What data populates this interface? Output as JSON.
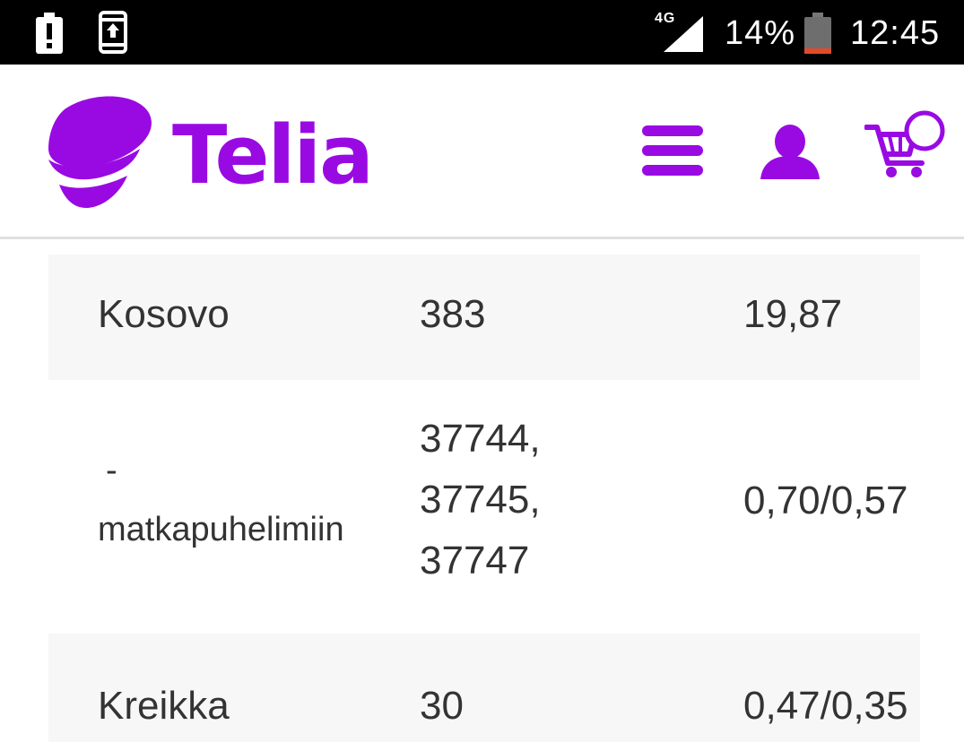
{
  "status_bar": {
    "network_type": "4G",
    "battery_percent": "14%",
    "time": "12:45",
    "icons": [
      "battery-alert-icon",
      "upload-icon",
      "signal-icon",
      "battery-icon"
    ],
    "battery_level": 0.14
  },
  "header": {
    "logo_text": "Telia",
    "brand_color": "#990ae3",
    "icons": [
      "menu-icon",
      "user-icon",
      "cart-icon"
    ]
  },
  "table": {
    "rows": [
      {
        "name": "Kosovo",
        "code": "383",
        "price": "19,87"
      },
      {
        "name_dash": "-",
        "name": "matkapuhelimiin",
        "code_lines": [
          "37744,",
          "37745,",
          "37747"
        ],
        "price": "0,70/0,57"
      },
      {
        "name": "Kreikka",
        "code": "30",
        "price": "0,47/0,35"
      }
    ]
  }
}
